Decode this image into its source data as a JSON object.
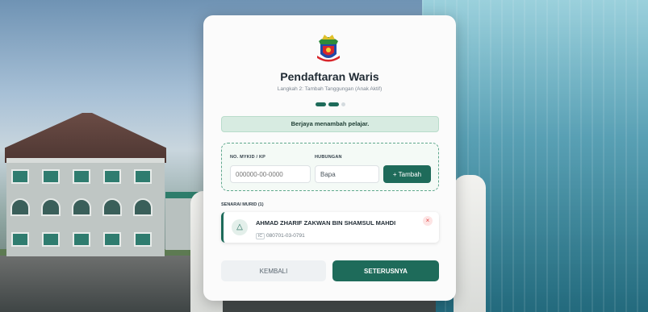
{
  "header": {
    "title": "Pendaftaran Waris",
    "subtitle": "Langkah 2: Tambah Tanggungan (Anak Aktif)",
    "step_current": 2,
    "step_total": 3
  },
  "alert": {
    "success_message": "Berjaya menambah pelajar."
  },
  "form": {
    "mykid_label": "NO. MYKID / KP",
    "mykid_placeholder": "000000-00-0000",
    "hubungan_label": "HUBUNGAN",
    "hubungan_value": "Bapa",
    "add_button_label": "+ Tambah"
  },
  "student_list": {
    "label": "SENARAI MURID (1)",
    "items": [
      {
        "name": "AHMAD ZHARIF ZAKWAN BIN SHAMSUL MAHDI",
        "ic": "080701-03-0791"
      }
    ]
  },
  "actions": {
    "back_label": "KEMBALI",
    "next_label": "SETERUSNYA"
  },
  "colors": {
    "primary": "#1e6b5a",
    "success_bg": "#d7ebe1"
  },
  "icons": {
    "crest": "state-crest-icon",
    "student": "student-avatar-icon",
    "remove": "close-icon",
    "ic": "id-card-icon"
  }
}
